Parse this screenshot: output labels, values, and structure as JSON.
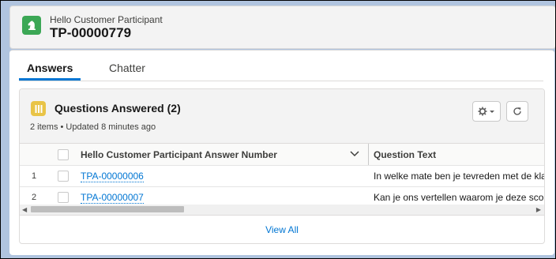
{
  "header": {
    "object_label": "Hello Customer Participant",
    "record_name": "TP-00000779",
    "icon": "knight-chess-icon",
    "icon_color": "#3ba755"
  },
  "tabs": [
    {
      "label": "Answers",
      "active": true
    },
    {
      "label": "Chatter",
      "active": false
    }
  ],
  "related_list": {
    "icon": "list-icon",
    "icon_color": "#e9c447",
    "title": "Questions Answered (2)",
    "subtitle": "2 items • Updated 8 minutes ago",
    "gear_button": "gear-icon",
    "refresh_button": "refresh-icon",
    "columns": [
      "Hello Customer Participant Answer Number",
      "Question Text"
    ],
    "rows": [
      {
        "num": "1",
        "answer": "TPA-00000006",
        "question": "In welke mate ben je tevreden met de klante"
      },
      {
        "num": "2",
        "answer": "TPA-00000007",
        "question": "Kan je ons vertellen waarom je deze score ge"
      }
    ],
    "view_all": "View All"
  },
  "colors": {
    "accent": "#0176d3"
  }
}
